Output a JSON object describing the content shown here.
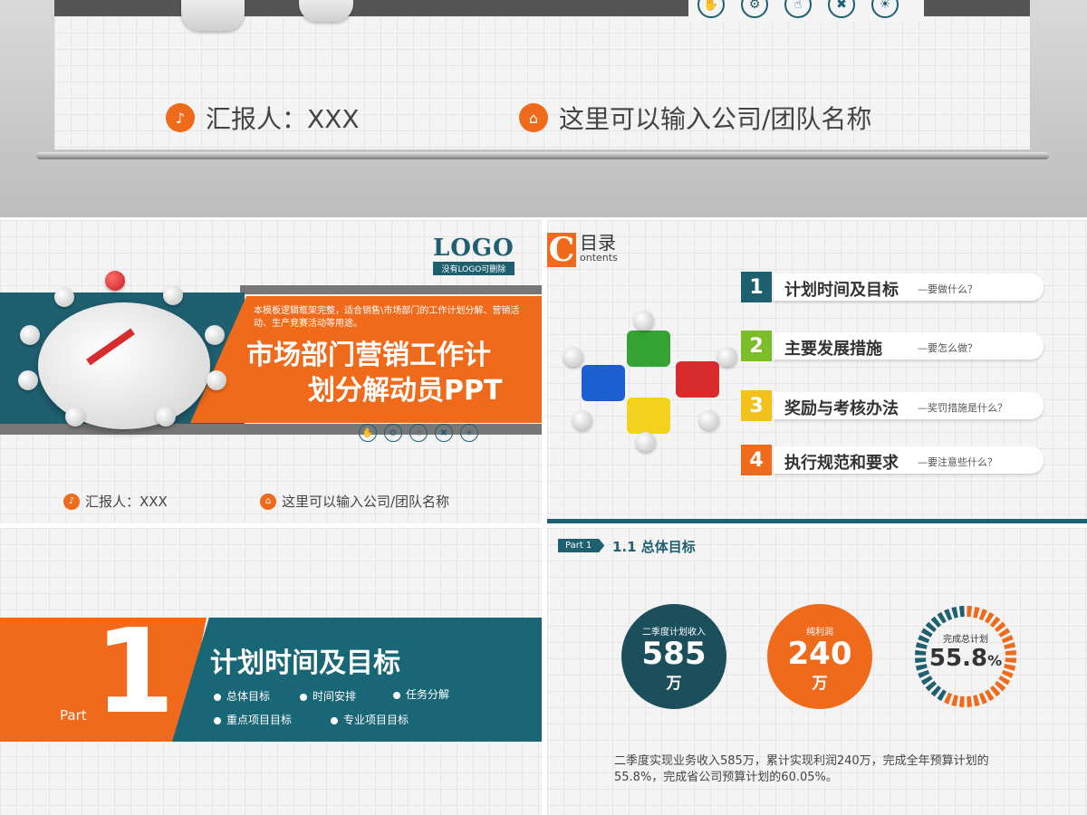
{
  "slide_top": {
    "reporter": "汇报人：XXX",
    "company": "这里可以输入公司/团队名称"
  },
  "slide_cover": {
    "logo": "LOGO",
    "logo_sub": "没有LOGO可删除",
    "desc": "本模板逻辑框架完整，适合销售\\市场部门的工作计划分解、营销活动、生产竞赛活动等用途。",
    "title_line1": "市场部门营销工作计",
    "title_line2": "划分解动员PPT",
    "reporter": "汇报人：XXX",
    "company": "这里可以输入公司/团队名称"
  },
  "slide_toc": {
    "c_letter": "C",
    "title": "目录",
    "subtitle": "ontents",
    "items": [
      {
        "num": "1",
        "title": "计划时间及目标",
        "sub": "—要做什么？",
        "color": "#1e5f70"
      },
      {
        "num": "2",
        "title": "主要发展措施",
        "sub": "—要怎么做？",
        "color": "#7cbd2b"
      },
      {
        "num": "3",
        "title": "奖励与考核办法",
        "sub": "—奖罚措施是什么？",
        "color": "#f2c21a"
      },
      {
        "num": "4",
        "title": "执行规范和要求",
        "sub": "—要注意些什么？",
        "color": "#ef6a1a"
      }
    ]
  },
  "slide_part": {
    "part_label": "Part",
    "part_num": "1",
    "title": "计划时间及目标",
    "bullets": [
      "总体目标",
      "时间安排",
      "任务分解",
      "重点项目目标",
      "专业项目目标"
    ]
  },
  "slide_goal": {
    "tag": "Part 1",
    "title": "1.1 总体目标",
    "circles": [
      {
        "label": "二季度计划收入",
        "value": "585",
        "unit": "万"
      },
      {
        "label": "纯利润",
        "value": "240",
        "unit": "万"
      },
      {
        "label": "完成总计划",
        "value": "55.8",
        "unit": "%"
      }
    ],
    "progress_fraction": 0.558,
    "description": "二季度实现业务收入585万，累计实现利润240万，完成全年预算计划的55.8%，完成省公司预算计划的60.05%。"
  },
  "colors": {
    "teal": "#1e5f70",
    "orange": "#ef6a1a",
    "green": "#7cbd2b",
    "yellow": "#f2c21a",
    "gray": "#666666"
  }
}
